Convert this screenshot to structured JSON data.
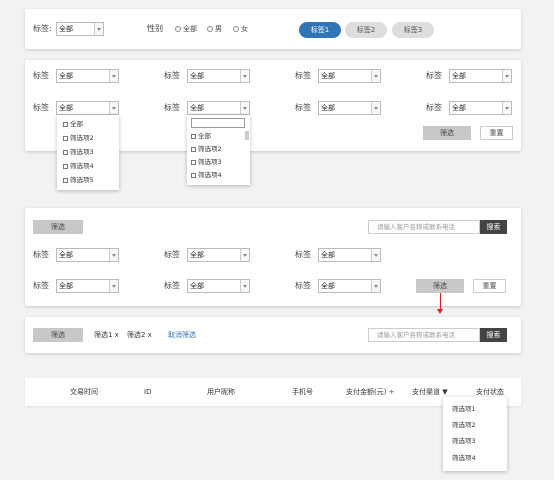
{
  "top_bar": {
    "tag_label": "标签:",
    "tag_select": "全部",
    "gender_label": "性别",
    "gender_options": [
      "全部",
      "男",
      "女"
    ],
    "pills": [
      "标签1",
      "标签2",
      "标签3"
    ],
    "active_pill": "标签1"
  },
  "filter_panel_1": {
    "label": "标签",
    "select_value": "全部",
    "dropdown_a": [
      "全部",
      "筛选项2",
      "筛选项3",
      "筛选项4",
      "筛选项5"
    ],
    "dropdown_b": [
      "全部",
      "筛选项2",
      "筛选项3",
      "筛选项4"
    ],
    "filter_button": "筛选",
    "reset_button": "重置"
  },
  "filter_panel_2": {
    "filter_button": "筛选",
    "search_placeholder": "请输入客户名称或联系电话",
    "search_button": "搜索",
    "label": "标签",
    "select_value": "全部",
    "filter_button_2": "筛选",
    "reset_button": "重置"
  },
  "filter_panel_3": {
    "filter_button": "筛选",
    "chips": [
      "筛选1 x",
      "筛选2 x"
    ],
    "clear_link": "取消筛选",
    "search_placeholder": "请输入客户名称或联系电话",
    "search_button": "搜索"
  },
  "table": {
    "headers": [
      "交易时间",
      "ID",
      "用户昵称",
      "手机号",
      "支付金额(元) ÷",
      "支付渠道 ▼",
      "支付状态"
    ],
    "channel_dropdown": [
      "筛选项1",
      "筛选项2",
      "筛选项3",
      "筛选项4"
    ]
  },
  "colors": {
    "accent": "#2f74b5",
    "arrow": "#e02020"
  }
}
